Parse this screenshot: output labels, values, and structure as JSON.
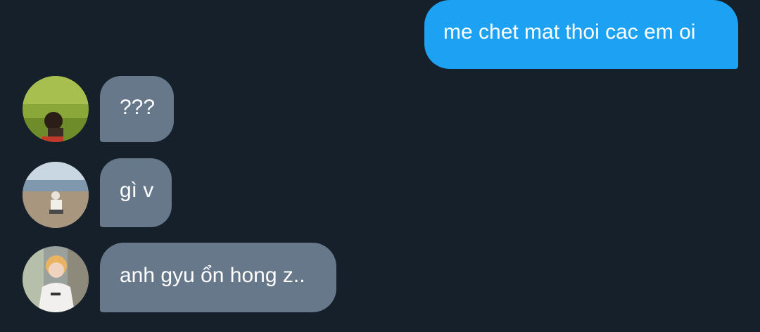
{
  "messages": [
    {
      "direction": "outgoing",
      "text": "me chet mat thoi cac em oi"
    },
    {
      "direction": "incoming",
      "text": "???",
      "avatar_icon": "user-avatar-grass-photo"
    },
    {
      "direction": "incoming",
      "text": "gì v",
      "avatar_icon": "user-avatar-beach-photo"
    },
    {
      "direction": "incoming",
      "text": "anh gyu ổn hong z..",
      "avatar_icon": "user-avatar-portrait-photo"
    }
  ],
  "colors": {
    "background": "#16202b",
    "outgoing_bubble": "#1da1f2",
    "incoming_bubble": "#66788a",
    "text": "#ffffff"
  }
}
